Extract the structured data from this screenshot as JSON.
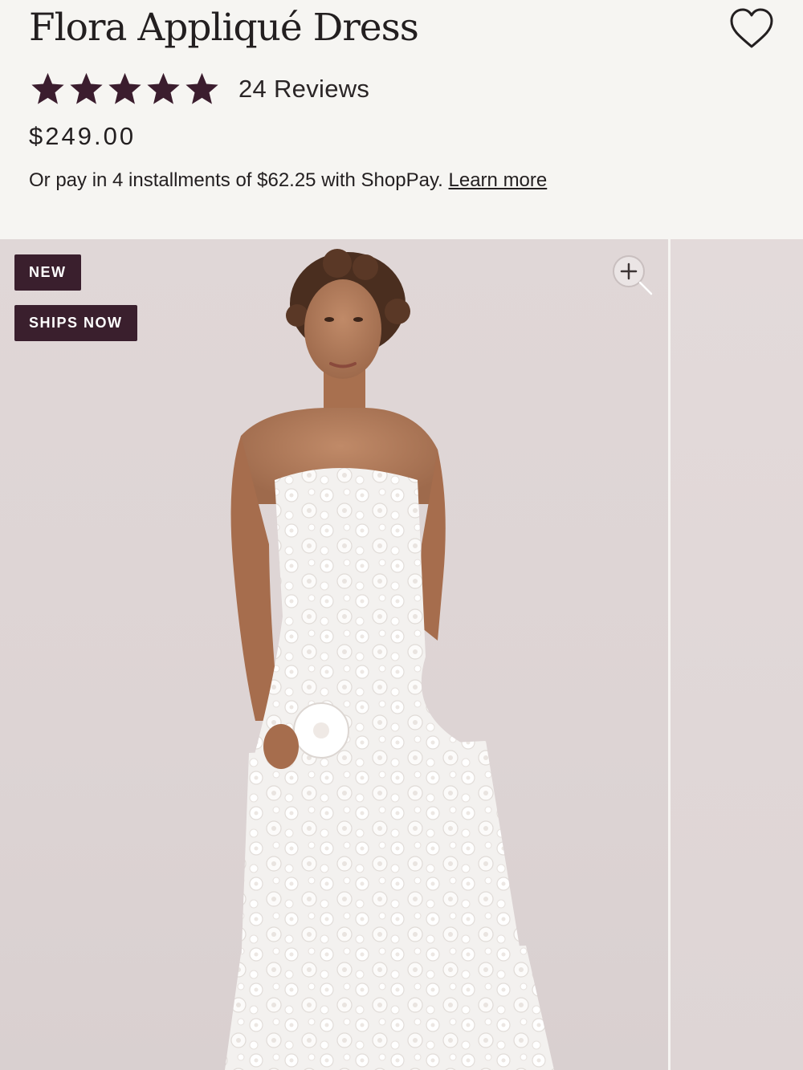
{
  "product": {
    "title": "Flora Appliqué Dress",
    "rating": 5,
    "rating_max": 5,
    "reviews_label": "24 Reviews",
    "price": "$249.00",
    "installments_text": "Or pay in 4 installments of $62.25 with ShopPay.",
    "learn_more_label": "Learn more"
  },
  "badges": {
    "new": "NEW",
    "ships_now": "SHIPS NOW"
  },
  "icons": {
    "favorite": "heart-outline-icon",
    "zoom": "zoom-in-icon",
    "star": "star-icon"
  },
  "colors": {
    "star": "#3b1d2e",
    "badge_bg": "#3a1f2d",
    "page_bg": "#f6f5f2",
    "image_bg": "#ddd4d4"
  }
}
